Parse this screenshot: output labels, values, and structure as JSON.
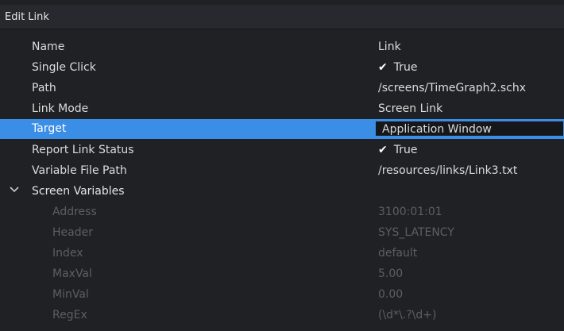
{
  "title": "Edit Link",
  "properties": [
    {
      "label": "Name",
      "value": "Link"
    },
    {
      "label": "Single Click",
      "value": "True",
      "check": true
    },
    {
      "label": "Path",
      "value": "/screens/TimeGraph2.schx"
    },
    {
      "label": "Link Mode",
      "value": "Screen Link"
    },
    {
      "label": "Target",
      "value": "Application Window",
      "selected": true
    },
    {
      "label": "Report Link Status",
      "value": "True",
      "check": true
    },
    {
      "label": "Variable File Path",
      "value": "/resources/links/Link3.txt"
    }
  ],
  "group": {
    "label": "Screen Variables",
    "expanded": true,
    "icon": "chevron-down-icon"
  },
  "screen_variables": [
    {
      "label": "Address",
      "value": "3100:01:01"
    },
    {
      "label": "Header",
      "value": "SYS_LATENCY"
    },
    {
      "label": "Index",
      "value": "default"
    },
    {
      "label": "MaxVal",
      "value": "5.00"
    },
    {
      "label": "MinVal",
      "value": "0.00"
    },
    {
      "label": "RegEx",
      "value": "(\\d*\\.?\\d+)"
    }
  ],
  "colors": {
    "background": "#1f2124",
    "title_bar": "#262a2e",
    "selection": "#3a8ee6",
    "text": "#dcdcdc",
    "disabled_text": "#5c5f63"
  }
}
